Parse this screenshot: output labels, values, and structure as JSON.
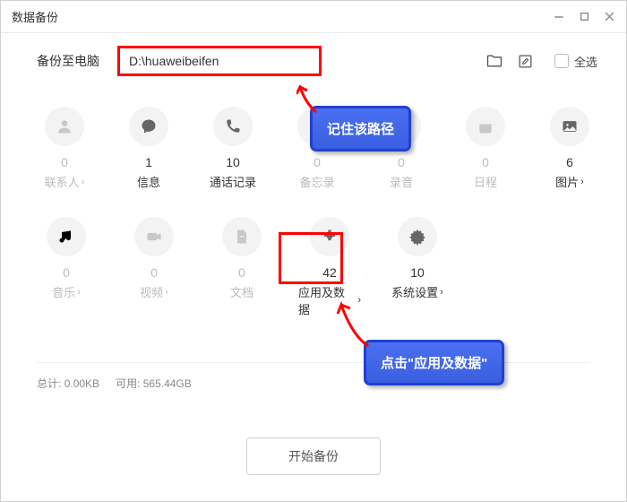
{
  "window": {
    "title": "数据备份"
  },
  "toolbar": {
    "backup_to_label": "备份至电脑",
    "path": "D:\\huaweibeifen",
    "select_all": "全选"
  },
  "items": [
    {
      "count": "0",
      "label": "联系人",
      "chev": true,
      "dark": false,
      "icon": "person"
    },
    {
      "count": "1",
      "label": "信息",
      "chev": false,
      "dark": true,
      "icon": "chat"
    },
    {
      "count": "10",
      "label": "通话记录",
      "chev": false,
      "dark": true,
      "icon": "phone"
    },
    {
      "count": "0",
      "label": "备忘录",
      "chev": false,
      "dark": false,
      "icon": "note"
    },
    {
      "count": "0",
      "label": "录音",
      "chev": false,
      "dark": false,
      "icon": "mic"
    },
    {
      "count": "0",
      "label": "日程",
      "chev": false,
      "dark": false,
      "icon": "calendar"
    },
    {
      "count": "6",
      "label": "图片",
      "chev": true,
      "dark": true,
      "icon": "image"
    },
    {
      "count": "0",
      "label": "音乐",
      "chev": true,
      "dark": false,
      "icon": "music"
    },
    {
      "count": "0",
      "label": "视频",
      "chev": true,
      "dark": false,
      "icon": "video"
    },
    {
      "count": "0",
      "label": "文档",
      "chev": false,
      "dark": false,
      "icon": "doc"
    },
    {
      "count": "42",
      "label": "应用及数据",
      "chev": true,
      "dark": true,
      "icon": "puzzle"
    },
    {
      "count": "10",
      "label": "系统设置",
      "chev": true,
      "dark": true,
      "icon": "gear"
    }
  ],
  "callouts": {
    "path": "记住该路径",
    "apps": "点击\"应用及数据\""
  },
  "stats": {
    "total_label": "总计:",
    "total_value": "0.00KB",
    "avail_label": "可用:",
    "avail_value": "565.44GB"
  },
  "footer": {
    "start": "开始备份"
  }
}
